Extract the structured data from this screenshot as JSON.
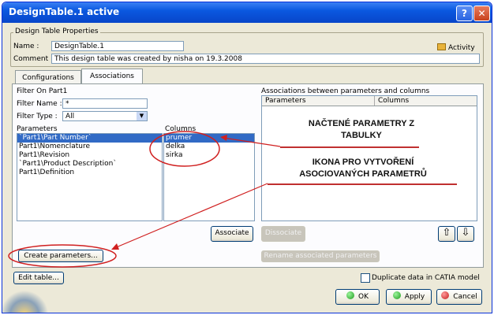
{
  "window": {
    "title": "DesignTable.1 active",
    "help": "?",
    "close": "✕"
  },
  "properties": {
    "group_label": "Design Table Properties",
    "name_label": "Name :",
    "name_value": "DesignTable.1",
    "comment_label": "Comment :",
    "comment_value": "This design table was created by nisha on 19.3.2008",
    "activity_label": "Activity"
  },
  "tabs": [
    {
      "label": "Configurations"
    },
    {
      "label": "Associations"
    }
  ],
  "filter": {
    "title": "Filter On Part1",
    "name_label": "Filter Name :",
    "name_value": "*",
    "type_label": "Filter Type :",
    "type_value": "All"
  },
  "parameters": {
    "header": "Parameters",
    "items": [
      "`Part1\\Part Number`",
      "Part1\\Nomenclature",
      "Part1\\Revision",
      "`Part1\\Product Description`",
      "Part1\\Definition"
    ]
  },
  "columns": {
    "header": "Columns",
    "items": [
      "prumer",
      "delka",
      "sirka"
    ]
  },
  "assoc": {
    "title": "Associations between parameters and columns",
    "col1": "Parameters",
    "col2": "Columns"
  },
  "buttons": {
    "associate": "Associate",
    "dissociate": "Dissociate",
    "create_parameters": "Create parameters...",
    "rename": "Rename associated parameters",
    "edit_table": "Edit table...",
    "ok": "OK",
    "apply": "Apply",
    "cancel": "Cancel",
    "up": "⇧",
    "down": "⇩"
  },
  "duplicate_label": "Duplicate data in CATIA model",
  "annotations": {
    "loaded_line1": "NAČTENÉ PARAMETRY Z",
    "loaded_line2": "TABULKY",
    "icon_line1": "IKONA PRO VYTVOŘENÍ",
    "icon_line2": "ASOCIOVANÝCH PARAMETRŮ"
  },
  "colors": {
    "titlebar": "#0a58e0",
    "highlight": "#316ac5",
    "annotation": "#c03030"
  }
}
